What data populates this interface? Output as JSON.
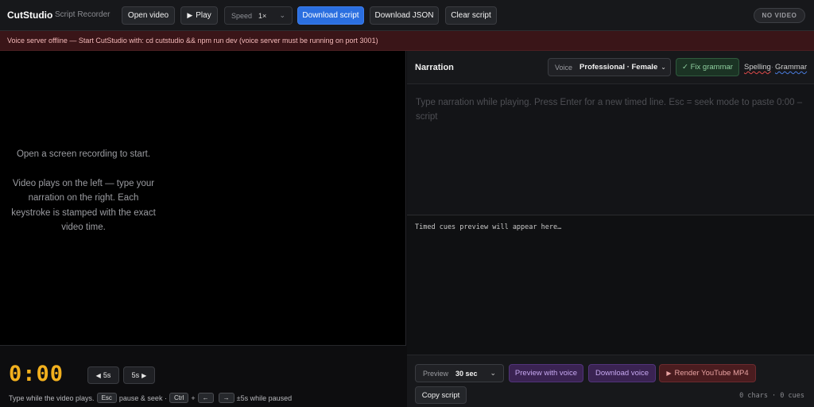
{
  "header": {
    "brand": "CutStudio",
    "subtitle": "Script Recorder",
    "open_video": "Open video",
    "play_icon": "▶",
    "play": "Play",
    "speed_label": "Speed",
    "speed_value": "1×",
    "download_script": "Download script",
    "download_json": "Download JSON",
    "clear_script": "Clear script",
    "status_badge": "NO VIDEO"
  },
  "alert": {
    "message": "Voice server offline — Start CutStudio with: cd cutstudio && npm run dev (voice server must be running on port 3001)"
  },
  "player": {
    "empty_line1": "Open a screen recording to start.",
    "empty_line2": "Video plays on the left — type your narration on the right. Each keystroke is stamped with the exact video time.",
    "timer": "0:00",
    "back_label": "5s",
    "forward_label": "5s",
    "hint": {
      "part1": "Type while the video plays.",
      "key_esc": "Esc",
      "part2": "pause & seek ·",
      "key_ctrl": "Ctrl",
      "plus1": "+",
      "key_left": "←",
      "plus2": "",
      "key_right": "→",
      "part3": "±5s while paused"
    }
  },
  "narration": {
    "title": "Narration",
    "voice_label": "Voice",
    "voice_value": "Professional · Female",
    "fix_grammar": "✓ Fix grammar",
    "spelling": "Spelling",
    "separator": "·",
    "grammar": "Grammar",
    "placeholder": "Type narration while playing. Press Enter for a new timed line. Esc = seek mode to paste 0:00 – script",
    "cues_placeholder": "Timed cues preview will appear here…"
  },
  "footer": {
    "preview_label": "Preview",
    "preview_value": "30 sec",
    "preview_voice": "Preview with voice",
    "download_voice": "Download voice",
    "render_icon": "▶",
    "render": "Render YouTube MP4",
    "copy_script": "Copy script",
    "stats": "0 chars · 0 cues"
  },
  "colors": {
    "accent": "#2b6fe0",
    "timer": "#f2b01e",
    "alert_bg": "#3a1518",
    "spelling_underline": "#e04a4a",
    "grammar_underline": "#4a7de0"
  }
}
